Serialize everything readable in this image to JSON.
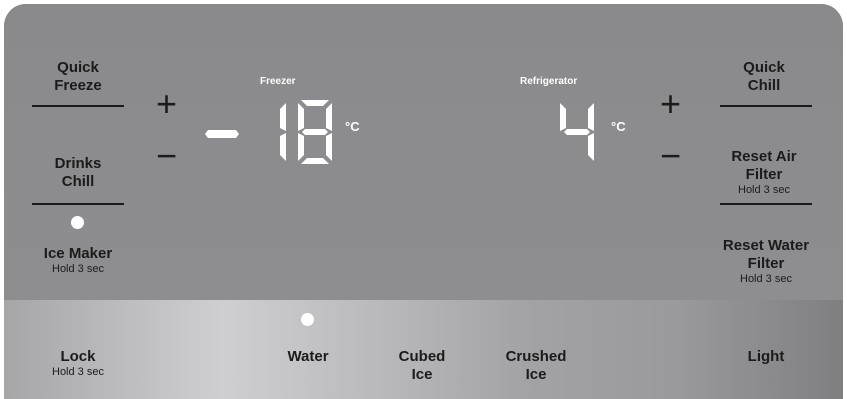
{
  "left_buttons": {
    "quick_freeze": {
      "label1": "Quick",
      "label2": "Freeze"
    },
    "drinks_chill": {
      "label1": "Drinks",
      "label2": "Chill"
    },
    "ice_maker": {
      "label": "Ice Maker",
      "sub": "Hold 3 sec"
    }
  },
  "freezer": {
    "title": "Freezer",
    "sign": "-",
    "temperature": "18",
    "unit": "°C",
    "plus": "+",
    "minus": "−"
  },
  "refrigerator": {
    "title": "Refrigerator",
    "temperature": "4",
    "unit": "°C",
    "plus": "+",
    "minus": "−"
  },
  "right_buttons": {
    "quick_chill": {
      "label1": "Quick",
      "label2": "Chill"
    },
    "reset_air_filter": {
      "label1": "Reset Air",
      "label2": "Filter",
      "sub": "Hold 3 sec"
    },
    "reset_water_filter": {
      "label1": "Reset Water",
      "label2": "Filter",
      "sub": "Hold 3 sec"
    }
  },
  "bottom_buttons": {
    "lock": {
      "label": "Lock",
      "sub": "Hold 3 sec"
    },
    "water": {
      "label": "Water"
    },
    "cubed_ice": {
      "label1": "Cubed",
      "label2": "Ice"
    },
    "crushed_ice": {
      "label1": "Crushed",
      "label2": "Ice"
    },
    "light": {
      "label": "Light"
    }
  },
  "indicators": {
    "ice_maker_light": "on",
    "water_light": "on"
  },
  "colors": {
    "panel": "#8c8c8e",
    "text": "#1b1b1b",
    "display_digits": "#ffffff",
    "indicator": "#ffffff"
  }
}
